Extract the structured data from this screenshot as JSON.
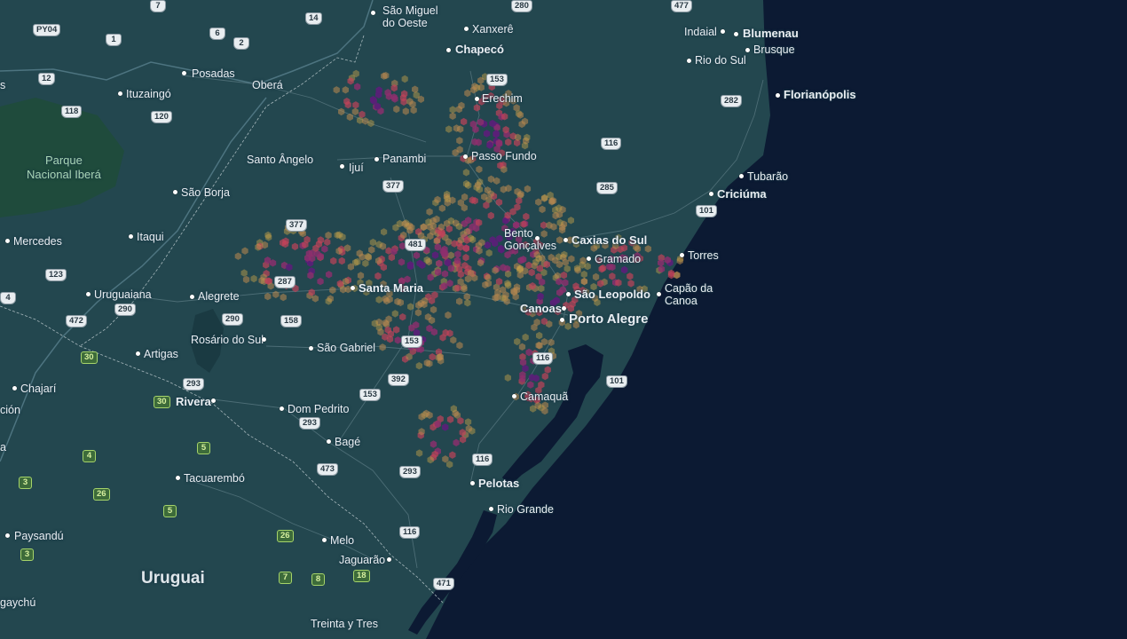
{
  "map": {
    "cities": [
      {
        "name": "São Miguel\ndo Oeste",
        "cls": ""
      },
      {
        "name": "Xanxerê",
        "cls": ""
      },
      {
        "name": "Chapecó",
        "cls": "big"
      },
      {
        "name": "Indaial",
        "cls": ""
      },
      {
        "name": "Blumenau",
        "cls": "big"
      },
      {
        "name": "Brusque",
        "cls": ""
      },
      {
        "name": "Rio do Sul",
        "cls": ""
      },
      {
        "name": "Florianópolis",
        "cls": "big"
      },
      {
        "name": "Posadas",
        "cls": ""
      },
      {
        "name": "Ituzaingó",
        "cls": ""
      },
      {
        "name": "Oberá",
        "cls": ""
      },
      {
        "name": "Erechim",
        "cls": ""
      },
      {
        "name": "Parque\nNacional Iberá",
        "cls": "park"
      },
      {
        "name": "Santo Ângelo",
        "cls": ""
      },
      {
        "name": "Ijuí",
        "cls": ""
      },
      {
        "name": "Panambi",
        "cls": ""
      },
      {
        "name": "Passo Fundo",
        "cls": ""
      },
      {
        "name": "Tubarão",
        "cls": ""
      },
      {
        "name": "Criciúma",
        "cls": "big"
      },
      {
        "name": "São Borja",
        "cls": ""
      },
      {
        "name": "Itaqui",
        "cls": ""
      },
      {
        "name": "Mercedes",
        "cls": ""
      },
      {
        "name": "Bento\nGonçalves",
        "cls": ""
      },
      {
        "name": "Caxias do Sul",
        "cls": "big"
      },
      {
        "name": "Gramado",
        "cls": ""
      },
      {
        "name": "Torres",
        "cls": ""
      },
      {
        "name": "Uruguaiana",
        "cls": ""
      },
      {
        "name": "Alegrete",
        "cls": ""
      },
      {
        "name": "Santa Maria",
        "cls": "big"
      },
      {
        "name": "São Leopoldo",
        "cls": "big"
      },
      {
        "name": "Capão da\nCanoa",
        "cls": ""
      },
      {
        "name": "Canoas",
        "cls": "big"
      },
      {
        "name": "Porto Alegre",
        "cls": "xl"
      },
      {
        "name": "Rosário do Sul",
        "cls": ""
      },
      {
        "name": "São Gabriel",
        "cls": ""
      },
      {
        "name": "Artigas",
        "cls": ""
      },
      {
        "name": "Chajarí",
        "cls": ""
      },
      {
        "name": "Camaquã",
        "cls": ""
      },
      {
        "name": "Rivera",
        "cls": "big"
      },
      {
        "name": "Dom Pedrito",
        "cls": ""
      },
      {
        "name": "Bagé",
        "cls": ""
      },
      {
        "name": "Tacuarembó",
        "cls": ""
      },
      {
        "name": "Pelotas",
        "cls": "big"
      },
      {
        "name": "Rio Grande",
        "cls": ""
      },
      {
        "name": "Paysandú",
        "cls": ""
      },
      {
        "name": "Melo",
        "cls": ""
      },
      {
        "name": "Jaguarão",
        "cls": ""
      },
      {
        "name": "Uruguai",
        "cls": "country"
      },
      {
        "name": "Treinta y Tres",
        "cls": ""
      },
      {
        "name": "gaychú",
        "cls": ""
      },
      {
        "name": "s",
        "cls": ""
      },
      {
        "name": "ción",
        "cls": ""
      },
      {
        "name": "a",
        "cls": ""
      }
    ],
    "shields": [
      {
        "n": "PY04",
        "g": false
      },
      {
        "n": "1",
        "g": false
      },
      {
        "n": "6",
        "g": false
      },
      {
        "n": "2",
        "g": false
      },
      {
        "n": "14",
        "g": false
      },
      {
        "n": "12",
        "g": false
      },
      {
        "n": "118",
        "g": false
      },
      {
        "n": "120",
        "g": false
      },
      {
        "n": "153",
        "g": false
      },
      {
        "n": "116",
        "g": false
      },
      {
        "n": "282",
        "g": false
      },
      {
        "n": "285",
        "g": false
      },
      {
        "n": "377",
        "g": false
      },
      {
        "n": "377",
        "g": false
      },
      {
        "n": "481",
        "g": false
      },
      {
        "n": "101",
        "g": false
      },
      {
        "n": "123",
        "g": false
      },
      {
        "n": "287",
        "g": false
      },
      {
        "n": "4",
        "g": false
      },
      {
        "n": "290",
        "g": false
      },
      {
        "n": "472",
        "g": false
      },
      {
        "n": "290",
        "g": false
      },
      {
        "n": "158",
        "g": false
      },
      {
        "n": "153",
        "g": false
      },
      {
        "n": "116",
        "g": false
      },
      {
        "n": "392",
        "g": false
      },
      {
        "n": "101",
        "g": false
      },
      {
        "n": "293",
        "g": false
      },
      {
        "n": "153",
        "g": false
      },
      {
        "n": "293",
        "g": false
      },
      {
        "n": "473",
        "g": false
      },
      {
        "n": "293",
        "g": false
      },
      {
        "n": "116",
        "g": false
      },
      {
        "n": "116",
        "g": false
      },
      {
        "n": "471",
        "g": false
      },
      {
        "n": "30",
        "g": true
      },
      {
        "n": "30",
        "g": true
      },
      {
        "n": "5",
        "g": true
      },
      {
        "n": "4",
        "g": true
      },
      {
        "n": "3",
        "g": true
      },
      {
        "n": "26",
        "g": true
      },
      {
        "n": "5",
        "g": true
      },
      {
        "n": "26",
        "g": true
      },
      {
        "n": "3",
        "g": true
      },
      {
        "n": "7",
        "g": true
      },
      {
        "n": "8",
        "g": true
      },
      {
        "n": "18",
        "g": true
      },
      {
        "n": "7",
        "g": false
      },
      {
        "n": "280",
        "g": false
      },
      {
        "n": "477",
        "g": false
      }
    ],
    "colors": {
      "land": "#23474f",
      "land_dark": "#1a3a42",
      "water": "#0c1a33",
      "park": "#1f4b3c",
      "road": "#6f8d96",
      "border": "#c8d4d8",
      "heat_low": "#c9a34a",
      "heat_mid": "#c2435a",
      "heat_high": "#5a1f78"
    }
  }
}
